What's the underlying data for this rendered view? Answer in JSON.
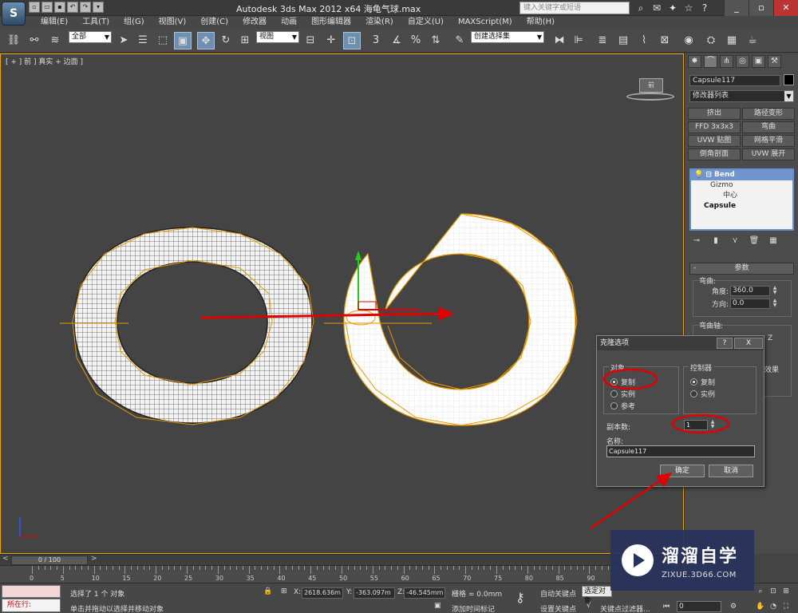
{
  "window": {
    "title": "Autodesk 3ds Max  2012 x64     海龟气球.max",
    "search_placeholder": "键入关键字或短语",
    "controls": [
      "_",
      "▫",
      "✕"
    ]
  },
  "menu": [
    "编辑(E)",
    "工具(T)",
    "组(G)",
    "视图(V)",
    "创建(C)",
    "修改器",
    "动画",
    "图形编辑器",
    "渲染(R)",
    "自定义(U)",
    "MAXScript(M)",
    "帮助(H)"
  ],
  "toolbar": {
    "selection_filter": "全部",
    "ref_coord": "视图",
    "named_selection": "创建选择集"
  },
  "viewport": {
    "label": "[ + ] 前 ] 真实 + 边面 ]",
    "viewcube_label": "前",
    "border_color": "#e9a500"
  },
  "command_panel": {
    "object_name": "Capsule117",
    "object_color": "#000000",
    "modifier_list": "修改器列表",
    "modifier_buttons": [
      "挤出",
      "路径变形",
      "FFD 3x3x3",
      "弯曲",
      "UVW 贴图",
      "网格平滑",
      "倒角剖面",
      "UVW 展开"
    ],
    "stack": {
      "bend": "Bend",
      "gizmo": "Gizmo",
      "center": "中心",
      "base": "Capsule"
    },
    "params_title": "参数",
    "bend_group": "弯曲:",
    "angle_label": "角度:",
    "angle_value": "360.0",
    "direction_label": "方向:",
    "direction_value": "0.0",
    "axis_group": "弯曲轴:",
    "axis_z": "Z",
    "effect_fragment": "效果"
  },
  "clone_dialog": {
    "title": "克隆选项",
    "help": "?",
    "close": "X",
    "object_group": "对象",
    "object_options": [
      {
        "label": "复制",
        "selected": true
      },
      {
        "label": "实例",
        "selected": false
      },
      {
        "label": "参考",
        "selected": false
      }
    ],
    "controller_group": "控制器",
    "controller_options": [
      {
        "label": "复制",
        "selected": true
      },
      {
        "label": "实例",
        "selected": false
      }
    ],
    "copies_label": "副本数:",
    "copies_value": "1",
    "name_label": "名称:",
    "name_value": "Capsule117",
    "ok": "确定",
    "cancel": "取消"
  },
  "timeline": {
    "slider": "0 / 100",
    "prev": "<",
    "next": ">",
    "ticks": [
      "0",
      "5",
      "10",
      "15",
      "20",
      "25",
      "30",
      "35",
      "40",
      "45",
      "50",
      "55",
      "60",
      "65",
      "70",
      "75",
      "80",
      "85",
      "90"
    ]
  },
  "status": {
    "running": "所在行:",
    "selected_msg": "选择了 1 个 对象",
    "prompt": "单击并拖动以选择并移动对象",
    "x_label": "X:",
    "x_value": "2618.636m",
    "y_label": "Y:",
    "y_value": "-363.097m",
    "z_label": "Z:",
    "z_value": "-46.545mm",
    "grid": "栅格 = 0.0mm",
    "add_time_tag": "添加时间标记",
    "auto_key": "自动关键点",
    "selected_obj": "选定对象",
    "set_key": "设置关键点",
    "key_filters": "关键点过滤器...",
    "frame": "0"
  },
  "watermark": {
    "title": "溜溜自学",
    "url": "ZIXUE.3D66.COM"
  },
  "colors": {
    "annotation_red": "#e00000",
    "selection_orange": "#e89a00"
  }
}
